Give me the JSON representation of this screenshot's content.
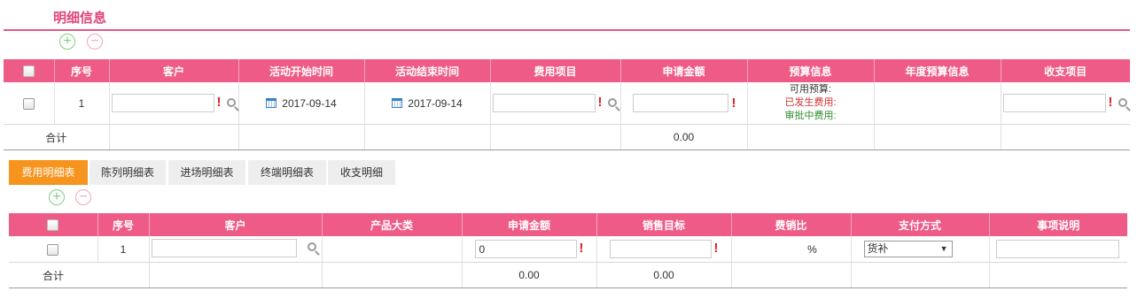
{
  "section_title": "明细信息",
  "icons": {
    "plus": "+",
    "minus": "−",
    "dropdown": "▼"
  },
  "table1": {
    "headers": [
      "序号",
      "客户",
      "活动开始时间",
      "活动结束时间",
      "费用项目",
      "申请金额",
      "预算信息",
      "年度预算信息",
      "收支项目"
    ],
    "row": {
      "index": "1",
      "start_date": "2017-09-14",
      "end_date": "2017-09-14",
      "budget_available": "可用预算:",
      "budget_incurred": "已发生费用:",
      "budget_pending": "审批中费用:"
    },
    "total_label": "合计",
    "total_amount": "0.00"
  },
  "tabs": [
    "费用明细表",
    "陈列明细表",
    "进场明细表",
    "终端明细表",
    "收支明细"
  ],
  "table2": {
    "headers": [
      "序号",
      "客户",
      "产品大类",
      "申请金额",
      "销售目标",
      "费销比",
      "支付方式",
      "事项说明"
    ],
    "row": {
      "index": "1",
      "amount": "0",
      "ratio_unit": "%",
      "payment_method": "货补"
    },
    "total_label": "合计",
    "total_amount": "0.00",
    "total_target": "0.00"
  },
  "colors": {
    "accent": "#ef5b87",
    "title": "#e0457b",
    "active_tab": "#f7941d"
  }
}
